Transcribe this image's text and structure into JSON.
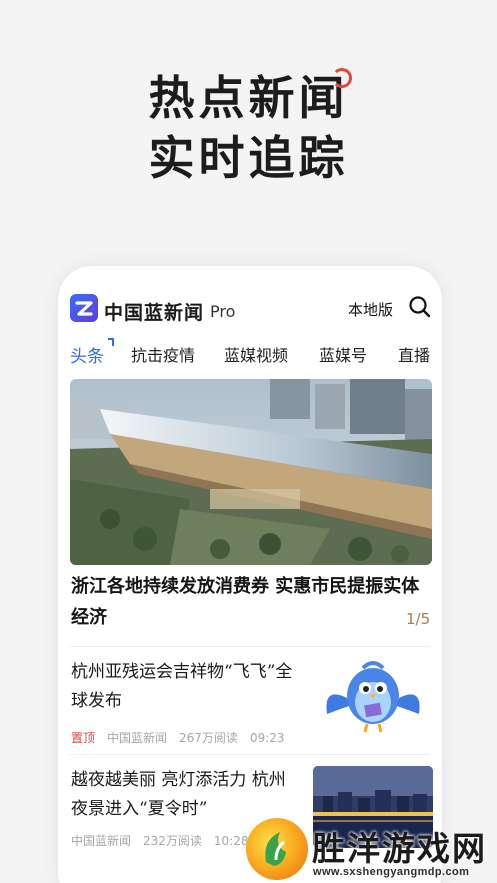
{
  "hero": {
    "line1": "热点新闻",
    "line2": "实时追踪"
  },
  "app": {
    "name": "中国蓝新闻",
    "badge": "Pro",
    "local_label": "本地版",
    "search_icon": "search-icon",
    "accent_color": "#2b6cf0"
  },
  "tabs": [
    {
      "label": "头条",
      "active": true
    },
    {
      "label": "抗击疫情",
      "active": false
    },
    {
      "label": "蓝媒视频",
      "active": false
    },
    {
      "label": "蓝媒号",
      "active": false
    },
    {
      "label": "直播",
      "active": false
    }
  ],
  "feature": {
    "title": "浙江各地持续发放消费券 实惠市民提振实体经济",
    "pager": "1/5"
  },
  "news": [
    {
      "title": "杭州亚残运会吉祥物“飞飞”全球发布",
      "pin": "置顶",
      "source": "中国蓝新闻",
      "reads": "267万阅读",
      "time": "09:23"
    },
    {
      "title": "越夜越美丽 亮灯添活力 杭州夜景进入“夏令时”",
      "source": "中国蓝新闻",
      "reads": "232万阅读",
      "time": "10:28"
    }
  ],
  "watermark": {
    "text": "胜洋游戏网",
    "url": "www.sxshengyangmdp.com"
  }
}
